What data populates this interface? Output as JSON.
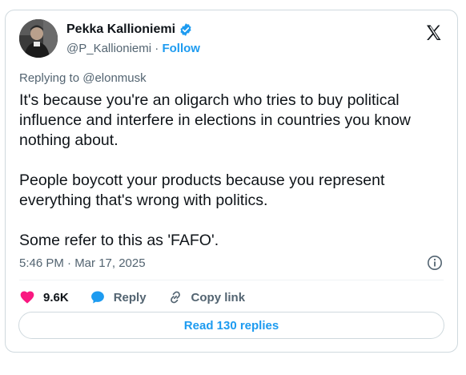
{
  "author": {
    "name": "Pekka Kallioniemi",
    "handle": "@P_Kallioniemi",
    "separator": "·",
    "follow_label": "Follow"
  },
  "tweet": {
    "replying_to": "Replying to @elonmusk",
    "paragraphs": [
      "It's because you're an oligarch who tries to buy political influence and interfere in elections in countries you know nothing about.",
      "People boycott your products because you represent everything that's wrong with politics.",
      "Some refer to this as 'FAFO'."
    ],
    "timestamp": "5:46 PM · Mar 17, 2025"
  },
  "actions": {
    "likes": "9.6K",
    "reply_label": "Reply",
    "copy_link_label": "Copy link"
  },
  "read_replies_label": "Read 130 replies",
  "colors": {
    "accent": "#1d9bf0",
    "like": "#f91880",
    "muted": "#536471",
    "text": "#0f1419",
    "border": "#cfd9de"
  },
  "icons": [
    "x-logo-icon",
    "verified-badge-icon",
    "info-icon",
    "heart-icon",
    "reply-bubble-icon",
    "link-icon"
  ]
}
